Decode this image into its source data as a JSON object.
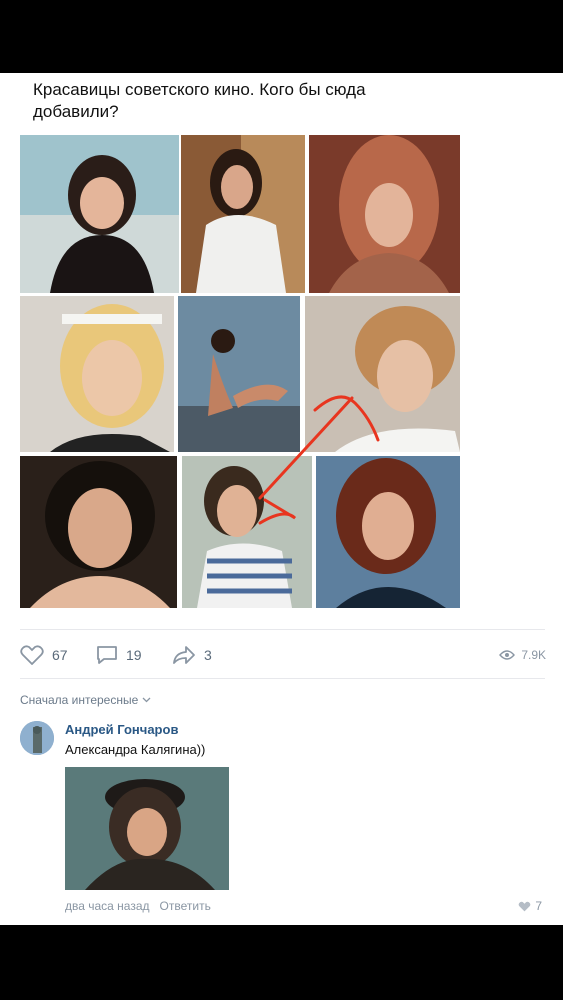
{
  "post": {
    "text": "Красавицы советского кино. Кого бы сюда добавили?",
    "photos": [
      {
        "name": "photo-actress-1"
      },
      {
        "name": "photo-actress-2"
      },
      {
        "name": "photo-actress-3"
      },
      {
        "name": "photo-actress-4"
      },
      {
        "name": "photo-actress-5"
      },
      {
        "name": "photo-actress-6"
      },
      {
        "name": "photo-actress-7"
      },
      {
        "name": "photo-actress-8"
      },
      {
        "name": "photo-actress-9"
      }
    ],
    "likes": "67",
    "comments": "19",
    "shares": "3",
    "views": "7.9K"
  },
  "comments": {
    "sort_label": "Сначала интересные",
    "items": [
      {
        "author": "Андрей Гончаров",
        "text": "Александра Калягина))",
        "time": "два часа назад",
        "reply": "Ответить",
        "likes": "7"
      }
    ]
  },
  "icons": [
    "heart-icon",
    "comment-icon",
    "share-icon",
    "eye-icon",
    "chevron-down-icon"
  ],
  "colors": {
    "link": "#2a5885",
    "muted": "#8a96a3",
    "annotation": "#e8351f"
  }
}
